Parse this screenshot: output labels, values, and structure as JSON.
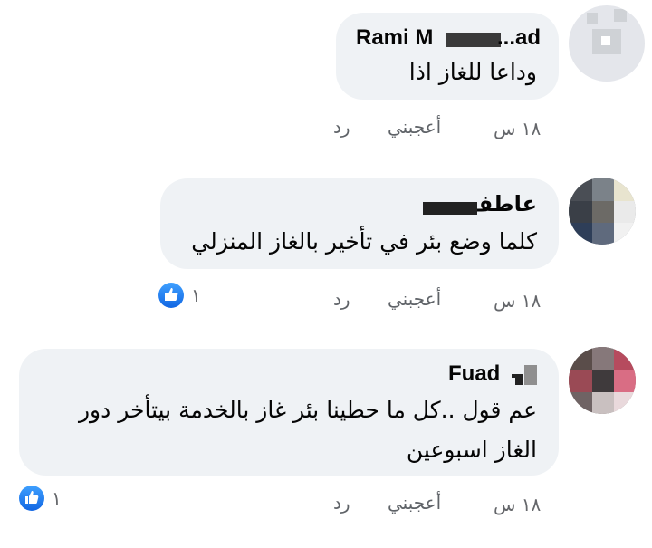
{
  "comments": [
    {
      "author": "Rami M",
      "author_suffix": "...ad",
      "text_lines": [
        "وداعا للغاز اذا"
      ],
      "time": "١٨ س",
      "like_label": "أعجبني",
      "reply_label": "رد"
    },
    {
      "author": "عاطف",
      "text_lines": [
        "كلما وضع بئر في تأخير بالغاز المنزلي"
      ],
      "time": "١٨ س",
      "like_label": "أعجبني",
      "reply_label": "رد",
      "reaction_count": "١",
      "reaction_icon": "like-icon"
    },
    {
      "author": "Fuad",
      "text_lines": [
        "عم قول ..كل ما حطينا بئر غاز بالخدمة بيتأخر دور",
        "الغاز اسبوعين"
      ],
      "time": "١٨ س",
      "like_label": "أعجبني",
      "reply_label": "رد",
      "reaction_count": "١",
      "reaction_icon": "like-icon"
    }
  ],
  "colors": {
    "bubble": "#eff2f5",
    "like_blue": "#1877f2",
    "meta_text": "#65676b"
  }
}
